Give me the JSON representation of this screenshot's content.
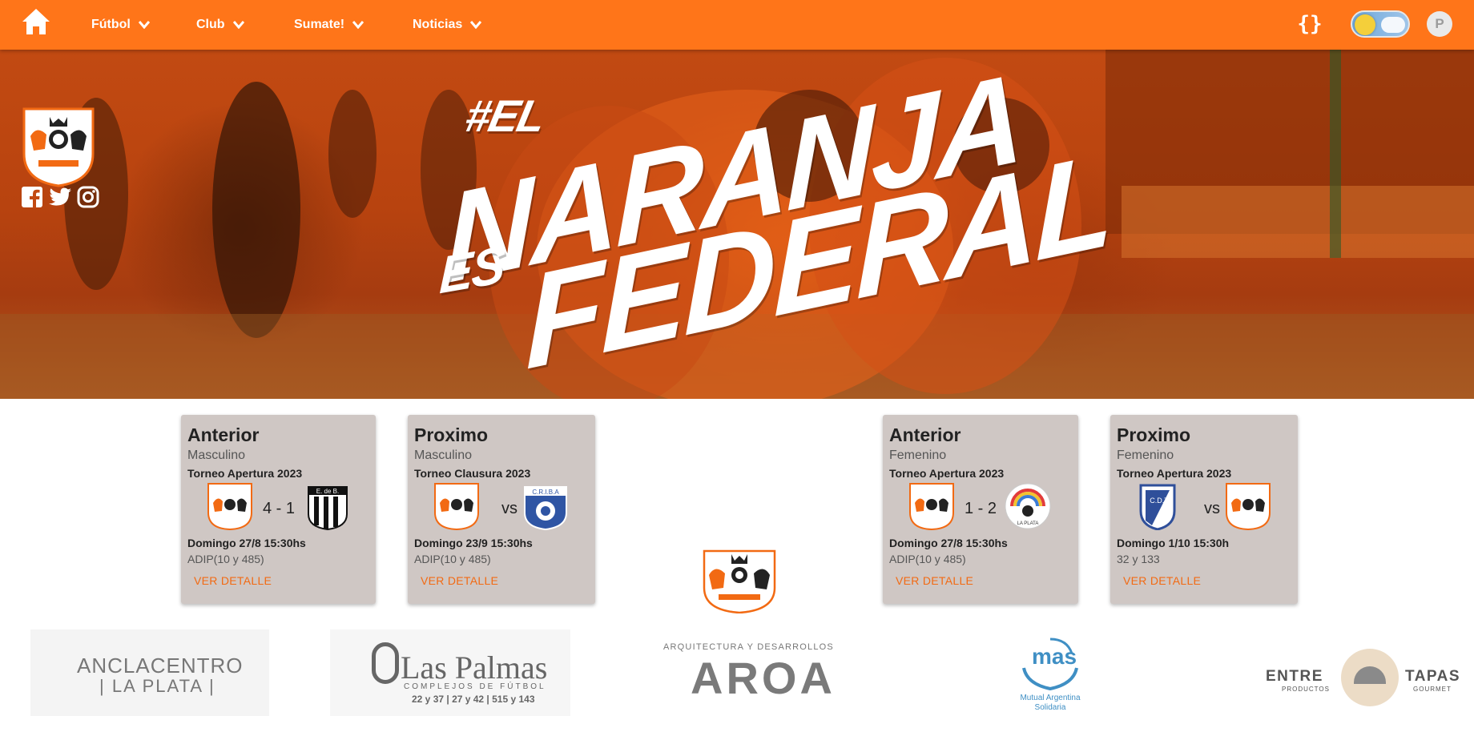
{
  "nav": {
    "items": [
      {
        "label": "Fútbol"
      },
      {
        "label": "Club"
      },
      {
        "label": "Sumate!"
      },
      {
        "label": "Noticias"
      }
    ],
    "braces_label": "{}",
    "avatar_letter": "P"
  },
  "hero": {
    "line1": "#EL",
    "line2": "NARANJA",
    "line3": "ES",
    "line4": "FEDERAL",
    "social": [
      "facebook-icon",
      "twitter-icon",
      "instagram-icon"
    ]
  },
  "cards": [
    {
      "title": "Anterior",
      "category": "Masculino",
      "tournament": "Torneo Apertura 2023",
      "home_crest": "adip-crest",
      "result": "4 - 1",
      "away_crest": "estudiantes-de-berisso-crest",
      "away_crest_text": "E. de B.",
      "date": "Domingo 27/8 15:30hs",
      "venue": "ADIP(10 y 485)",
      "detail": "VER DETALLE"
    },
    {
      "title": "Proximo",
      "category": "Masculino",
      "tournament": "Torneo Clausura 2023",
      "home_crest": "adip-crest",
      "result": "vs",
      "away_crest": "criba-crest",
      "away_crest_text": "C.R.I.B.A",
      "date": "Domingo 23/9 15:30hs",
      "venue": "ADIP(10 y 485)",
      "detail": "VER DETALLE"
    },
    {
      "title": "Anterior",
      "category": "Femenino",
      "tournament": "Torneo Apertura 2023",
      "home_crest": "adip-crest",
      "result": "1 - 2",
      "away_crest": "asociacion-rge-crest",
      "away_crest_text": "LA PLATA",
      "date": "Domingo 27/8 15:30hs",
      "venue": "ADIP(10 y 485)",
      "detail": "VER DETALLE"
    },
    {
      "title": "Proximo",
      "category": "Femenino",
      "tournament": "Torneo Apertura 2023",
      "home_crest": "cdt-crest",
      "result": "vs",
      "away_crest": "adip-crest",
      "away_crest_text": "C.D.T",
      "date": "Domingo 1/10 15:30h",
      "venue": "32 y 133",
      "detail": "VER DETALLE"
    }
  ],
  "sponsors": {
    "ancla": {
      "line1": "ANCLACENTRO",
      "line2": "| LA PLATA |"
    },
    "palmas": {
      "name": "Las Palmas",
      "sub": "COMPLEJOS DE FÚTBOL",
      "addr": "22 y 37 | 27 y 42 | 515 y 143"
    },
    "aroa": {
      "top": "ARQUITECTURA Y DESARROLLOS",
      "name": "AROA"
    },
    "mas": {
      "name": "mas",
      "sub1": "Mutual Argentina",
      "sub2": "Solidaria"
    },
    "entre": {
      "w1": "ENTRE",
      "w1s": "PRODUCTOS",
      "w2": "TAPAS",
      "w2s": "GOURMET"
    }
  },
  "colors": {
    "brand_orange": "#ff7519",
    "card_bg": "#cfc7c4",
    "link_orange": "#f26a13"
  }
}
